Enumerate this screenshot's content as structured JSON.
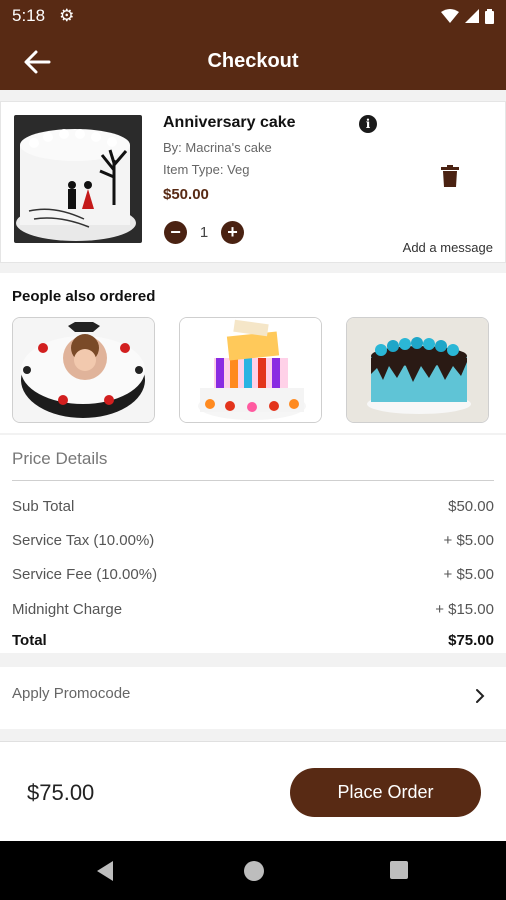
{
  "status_bar": {
    "time": "5:18",
    "icons": [
      "gear-icon",
      "wifi-icon",
      "signal-icon",
      "battery-icon"
    ]
  },
  "app_bar": {
    "title": "Checkout",
    "back_icon": "arrow-left-icon"
  },
  "cart_item": {
    "name": "Anniversary cake",
    "by": "By: Macrina's cake",
    "item_type": "Item Type: Veg",
    "price": "$50.00",
    "quantity": "1",
    "add_message": "Add a message",
    "icons": [
      "info-icon",
      "trash-icon",
      "minus-icon",
      "plus-icon"
    ]
  },
  "people_also_ordered": {
    "title": "People also ordered",
    "items": [
      "photo-cake",
      "striped-tier-cake",
      "blue-rose-drip-cake"
    ]
  },
  "price_details": {
    "title": "Price Details",
    "rows": [
      {
        "label": "Sub Total",
        "value": "$50.00"
      },
      {
        "label": "Service Tax (10.00%)",
        "value": "+ $5.00"
      },
      {
        "label": "Service Fee (10.00%)",
        "value": "+ $5.00"
      },
      {
        "label": "Midnight Charge",
        "value": "+ $15.00"
      }
    ],
    "total": {
      "label": "Total",
      "value": "$75.00"
    }
  },
  "promo": {
    "label": "Apply Promocode"
  },
  "footer": {
    "total": "$75.00",
    "place_order": "Place Order"
  },
  "colors": {
    "brand": "#582a14",
    "accent_dark": "#4a2212"
  }
}
